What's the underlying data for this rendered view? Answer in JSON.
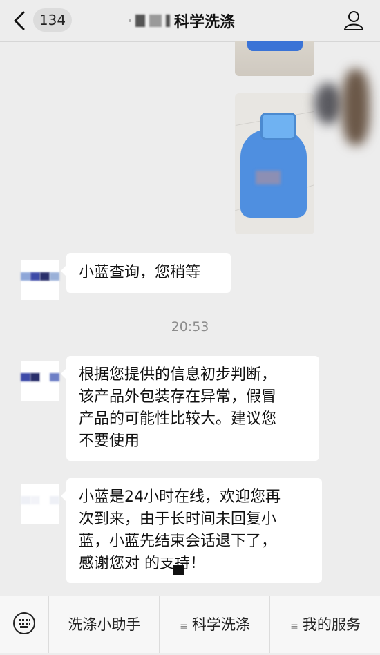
{
  "header": {
    "badge": "134",
    "title": "科学洗涤"
  },
  "messages": {
    "m1": "小蓝查询，您稍等",
    "time": "20:53",
    "m2_lines": [
      "根据您提供的信息初步判断，",
      "该产品外包装存在异常，假冒",
      "产品的可能性比较大。建议您",
      "不要使用"
    ],
    "m3_lines": [
      "小蓝是24小时在线，欢迎您再",
      "次到来，由于长时间未回复小",
      "蓝，小蓝先结束会话退下了，",
      "感谢您对      的支持！"
    ]
  },
  "menu": {
    "items": [
      {
        "label": "洗涤小助手",
        "icon": ""
      },
      {
        "label": "科学洗涤",
        "icon": "menu-lines-icon"
      },
      {
        "label": "我的服务",
        "icon": "menu-lines-icon"
      }
    ]
  },
  "colors": {
    "background": "#ededed",
    "bubble": "#ffffff",
    "bottle_blue": "#4f8fe0"
  }
}
